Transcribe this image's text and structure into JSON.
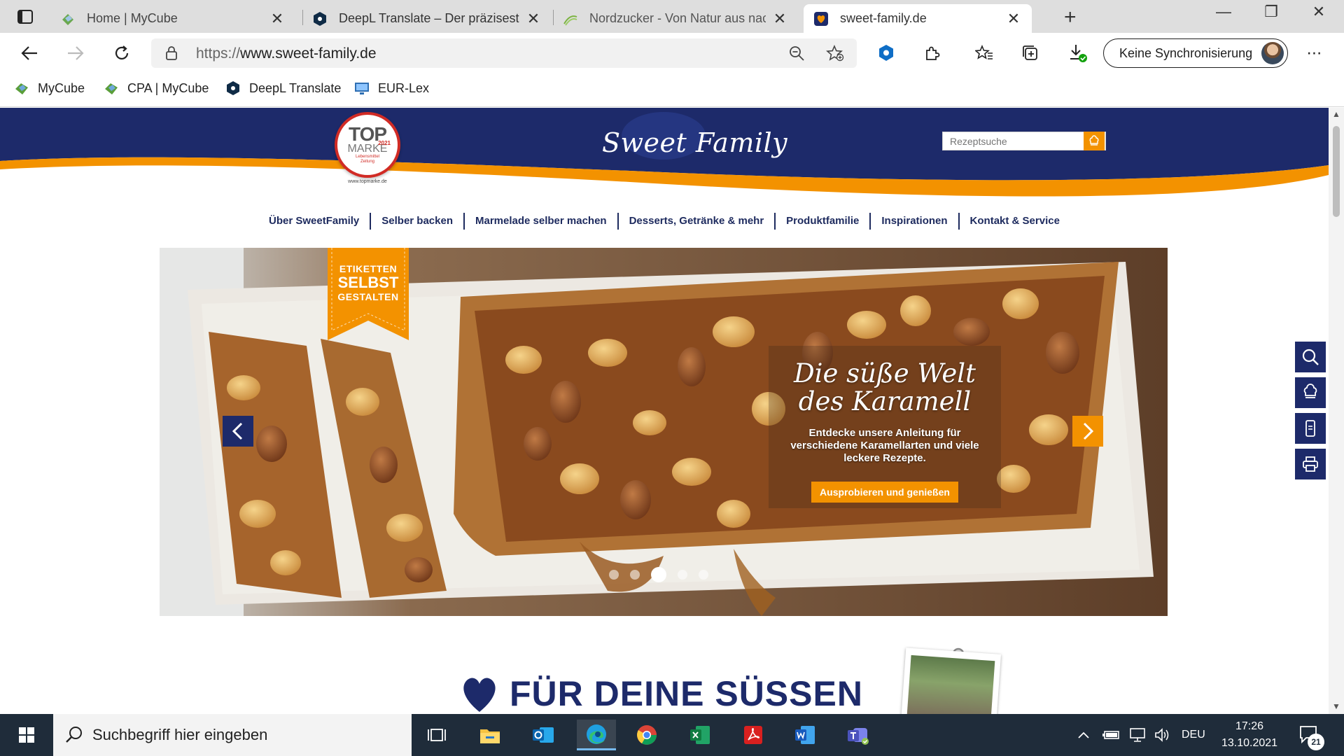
{
  "browser": {
    "tabs": [
      {
        "title": "Home | MyCube",
        "icon": "mycube-icon",
        "active": false
      },
      {
        "title": "DeepL Translate – Der präziseste",
        "icon": "deepl-icon",
        "active": false
      },
      {
        "title": "Nordzucker - Von Natur aus nach",
        "icon": "nordzucker-icon",
        "active": false
      },
      {
        "title": "sweet-family.de",
        "icon": "sweetfamily-icon",
        "active": true
      }
    ],
    "address": {
      "prefix": "https://",
      "host": "www.sweet-family.de"
    },
    "sync_label": "Keine Synchronisierung",
    "bookmarks": [
      {
        "label": "MyCube",
        "icon": "mycube-icon"
      },
      {
        "label": "CPA | MyCube",
        "icon": "mycube-icon"
      },
      {
        "label": "DeepL Translate",
        "icon": "deepl-icon"
      },
      {
        "label": "EUR-Lex",
        "icon": "eurlex-icon"
      }
    ]
  },
  "site": {
    "logo": "Sweet Family",
    "badge": {
      "line1": "TOP",
      "line2": "MARKE",
      "year": "2021",
      "sub1": "Lebensmittel",
      "sub2": "Zeitung",
      "url": "www.topmarke.de"
    },
    "search_placeholder": "Rezeptsuche",
    "nav": [
      "Über SweetFamily",
      "Selber backen",
      "Marmelade selber machen",
      "Desserts, Getränke & mehr",
      "Produktfamilie",
      "Inspirationen",
      "Kontakt & Service"
    ],
    "ribbon": {
      "line1": "ETIKETTEN",
      "line2": "SELBST",
      "line3": "GESTALTEN"
    },
    "slide": {
      "headline1": "Die süße Welt",
      "headline2": "des Karamell",
      "text": "Entdecke unsere Anleitung für verschiedene Karamellarten und viele leckere Rezepte.",
      "button": "Ausprobieren und genießen"
    },
    "slider_dots": {
      "count": 5,
      "active_index": 2
    },
    "section_title": "FÜR DEINE SÜSSEN",
    "colors": {
      "brand_blue": "#1d2a6a",
      "brand_orange": "#f39200",
      "badge_red": "#d12b25"
    }
  },
  "taskbar": {
    "search_placeholder": "Suchbegriff hier eingeben",
    "apps": [
      "task-view-icon",
      "file-explorer-icon",
      "outlook-icon",
      "edge-icon",
      "chrome-icon",
      "excel-icon",
      "acrobat-icon",
      "word-icon",
      "teams-icon"
    ],
    "language": "DEU",
    "time": "17:26",
    "date": "13.10.2021",
    "notifications": "21"
  }
}
